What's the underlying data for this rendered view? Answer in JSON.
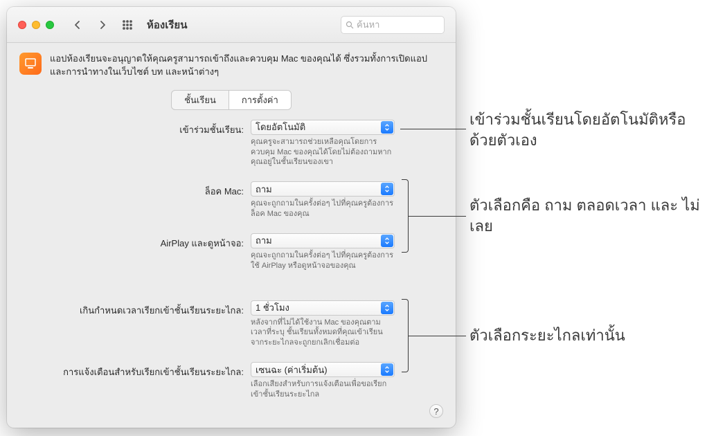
{
  "window": {
    "title": "ห้องเรียน",
    "search_placeholder": "ค้นหา",
    "description": "แอปห้องเรียนจะอนุญาตให้คุณครูสามารถเข้าถึงและควบคุม Mac ของคุณได้ ซึ่งรวมทั้งการเปิดแอปและการนำทางในเว็บไซต์ บท และหน้าต่างๆ"
  },
  "tabs": {
    "classes": "ชั้นเรียน",
    "settings": "การตั้งค่า"
  },
  "fields": {
    "join_class": {
      "label": "เข้าร่วมชั้นเรียน:",
      "value": "โดยอัตโนมัติ",
      "help": "คุณครูจะสามารถช่วยเหลือคุณโดยการควบคุม Mac ของคุณได้โดยไม่ต้องถามหากคุณอยู่ในชั้นเรียนของเขา"
    },
    "lock_mac": {
      "label": "ล็อค Mac:",
      "value": "ถาม",
      "help": "คุณจะถูกถามในครั้งต่อๆ ไปที่คุณครูต้องการล็อค Mac ของคุณ"
    },
    "airplay": {
      "label": "AirPlay และดูหน้าจอ:",
      "value": "ถาม",
      "help": "คุณจะถูกถามในครั้งต่อๆ ไปที่คุณครูต้องการใช้ AirPlay หรือดูหน้าจอของคุณ"
    },
    "remote_timeout": {
      "label": "เกินกำหนดเวลาเรียกเข้าชั้นเรียนระยะไกล:",
      "value": "1 ชั่วโมง",
      "help": "หลังจากที่ไม่ได้ใช้งาน Mac ของคุณตามเวลาที่ระบุ ชั้นเรียนทั้งหมดที่คุณเข้าเรียนจากระยะไกลจะถูกยกเลิกเชื่อมต่อ"
    },
    "remote_alert": {
      "label": "การแจ้งเตือนสำหรับเรียกเข้าชั้นเรียนระยะไกล:",
      "value": "เซนฉะ (ค่าเริ่มต้น)",
      "help": "เลือกเสียงสำหรับการแจ้งเตือนเพื่อขอเรียกเข้าชั้นเรียนระยะไกล"
    }
  },
  "help_button": "?",
  "callouts": {
    "c1": "เข้าร่วมชั้นเรียนโดยอัตโนมัติหรือด้วยตัวเอง",
    "c2": "ตัวเลือกคือ ถาม ตลอดเวลา และ ไม่เลย",
    "c3": "ตัวเลือกระยะไกลเท่านั้น"
  }
}
